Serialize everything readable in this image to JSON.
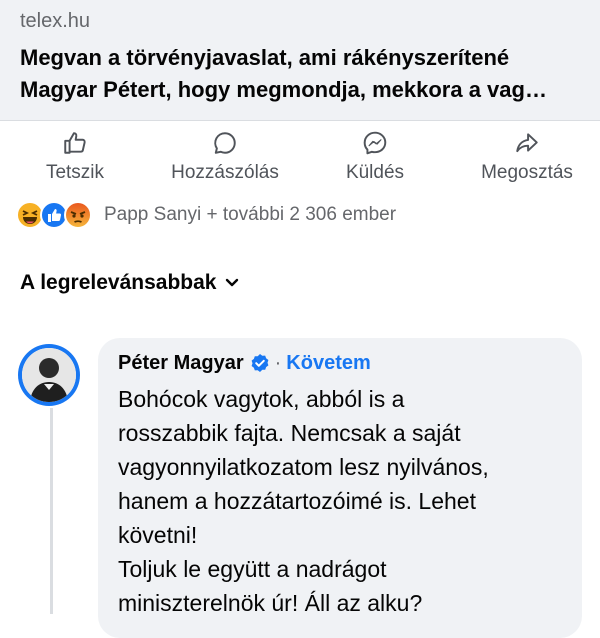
{
  "link_preview": {
    "domain": "telex.hu",
    "title_line1": "Megvan a törvényjavaslat, ami rákényszerítené",
    "title_line2": "Magyar Pétert, hogy megmondja, mekkora a vag…"
  },
  "actions": [
    {
      "label": "Tetszik",
      "icon": "thumbs-up-icon"
    },
    {
      "label": "Hozzászólás",
      "icon": "comment-icon"
    },
    {
      "label": "Küldés",
      "icon": "messenger-icon"
    },
    {
      "label": "Megosztás",
      "icon": "share-icon"
    }
  ],
  "reactions": {
    "icons": [
      "haha-icon",
      "like-icon",
      "angry-icon"
    ],
    "summary": "Papp Sanyi + további 2 306 ember"
  },
  "sort": {
    "label": "A legrelevánsabbak",
    "icon": "chevron-down-icon"
  },
  "comment": {
    "author": "Péter Magyar",
    "verified_icon": "verified-badge-icon",
    "separator": "·",
    "follow_label": "Követem",
    "lines": [
      "Bohócok vagytok, abból is a",
      "rosszabbik fajta. Nemcsak a saját",
      "vagyonnyilatkozatom lesz nyilvános,",
      "hanem a hozzátartozóimé is. Lehet",
      "követni!",
      "Toljuk le együtt a nadrágot",
      "miniszterelnök úr! Áll az alku?"
    ]
  },
  "colors": {
    "accent": "#1877f2",
    "card_bg": "#f0f2f5",
    "secondary_text": "#65676b"
  }
}
